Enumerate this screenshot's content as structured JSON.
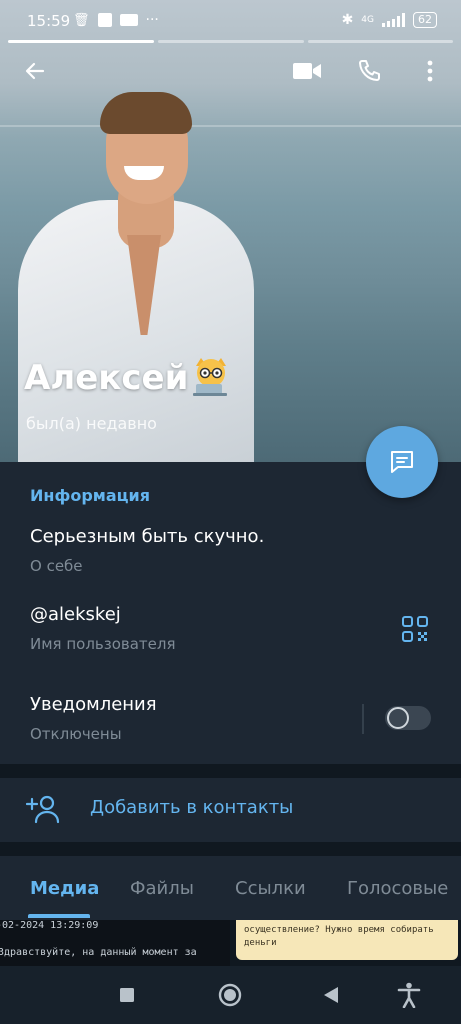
{
  "status_bar": {
    "time": "15:59",
    "network": "4G",
    "battery": "62"
  },
  "toolbar": {
    "back_icon": "arrow-left-icon",
    "video_icon": "video-call-icon",
    "call_icon": "phone-icon",
    "menu_icon": "more-vertical-icon"
  },
  "profile": {
    "name": "Алексей",
    "status": "был(а) недавно"
  },
  "info": {
    "title": "Информация",
    "bio": "Серьезным быть скучно.",
    "bio_label": "О себе",
    "username": "@alekskej",
    "username_label": "Имя пользователя",
    "notifications": "Уведомления",
    "notifications_state": "Отключены",
    "notifications_enabled": false
  },
  "actions": {
    "add_contact": "Добавить в контакты"
  },
  "tabs": [
    {
      "label": "Медиа",
      "active": true
    },
    {
      "label": "Файлы",
      "active": false
    },
    {
      "label": "Ссылки",
      "active": false
    },
    {
      "label": "Голосовые",
      "active": false
    }
  ],
  "media_preview": {
    "left_line1": "-02-2024 13:29:09",
    "left_line2": "Здравствуйте, на данный момент за",
    "right_text": "осуществление? Нужно время собирать деньги"
  },
  "colors": {
    "accent": "#64b5ef",
    "fab": "#5ea8e0",
    "background": "#17212b",
    "section": "#1d2733"
  }
}
